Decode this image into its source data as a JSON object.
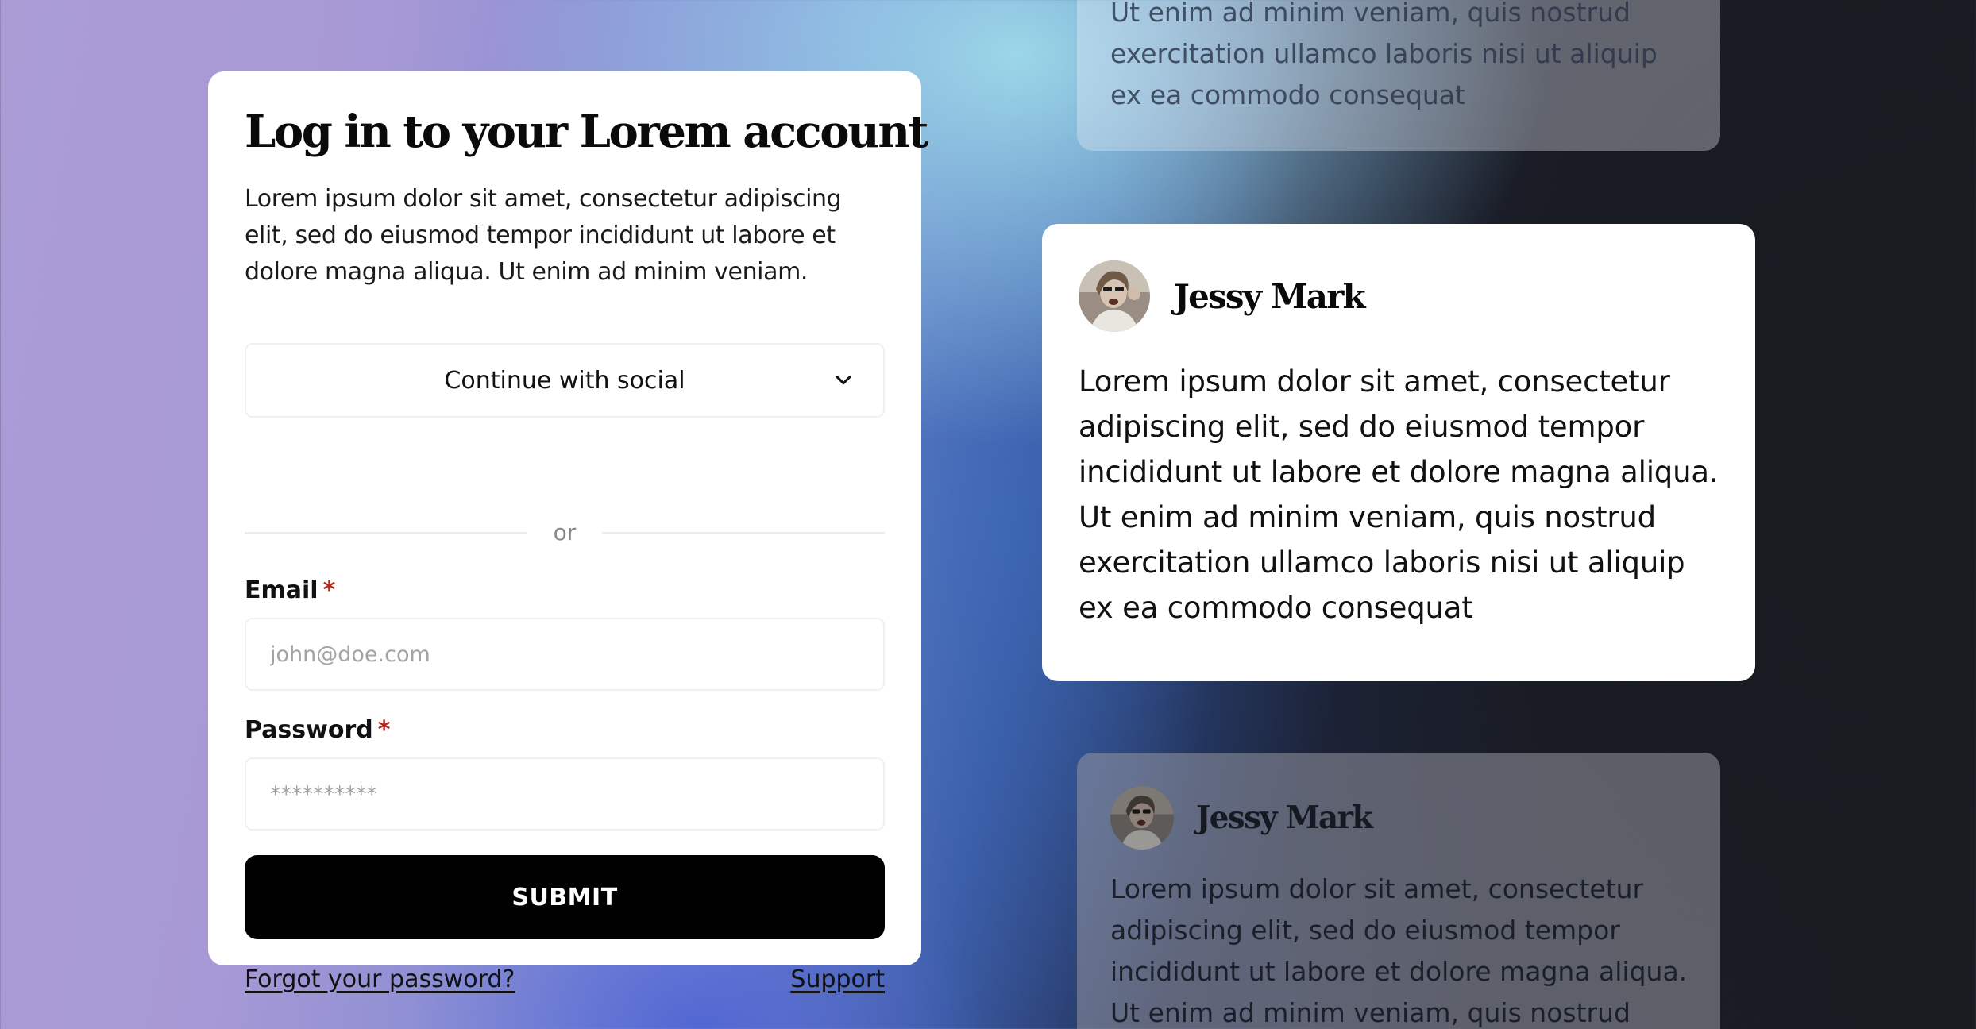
{
  "login": {
    "title": "Log in to your Lorem account",
    "description": "Lorem ipsum dolor sit amet, consectetur adipiscing elit, sed do eiusmod tempor incididunt ut labore et dolore magna aliqua. Ut enim ad minim veniam.",
    "social_select_label": "Continue with social",
    "divider_text": "or",
    "email_label": "Email",
    "email_placeholder": "john@doe.com",
    "password_label": "Password",
    "password_placeholder": "**********",
    "required_mark": "*",
    "submit_label": "SUBMIT",
    "forgot_password_link": "Forgot your password?",
    "support_link": "Support"
  },
  "testimonials": [
    {
      "name": "",
      "text": "Ut enim ad minim veniam, quis nostrud exercitation ullamco laboris nisi ut aliquip ex ea commodo consequat"
    },
    {
      "name": "Jessy Mark",
      "text": "Lorem ipsum dolor sit amet, consectetur adipiscing elit, sed do eiusmod tempor incididunt ut labore et dolore magna aliqua. Ut enim ad minim veniam, quis nostrud exercitation ullamco laboris nisi ut aliquip ex ea commodo consequat"
    },
    {
      "name": "Jessy Mark",
      "text": "Lorem ipsum dolor sit amet, consectetur adipiscing elit, sed do eiusmod tempor incididunt ut labore et dolore magna aliqua. Ut enim ad minim veniam, quis nostrud"
    }
  ],
  "colors": {
    "required": "#b3261e",
    "submit_bg": "#000000",
    "card_bg": "#ffffff"
  },
  "icons": {
    "social_select": "chevron-down-icon",
    "avatar": "avatar-photo"
  }
}
